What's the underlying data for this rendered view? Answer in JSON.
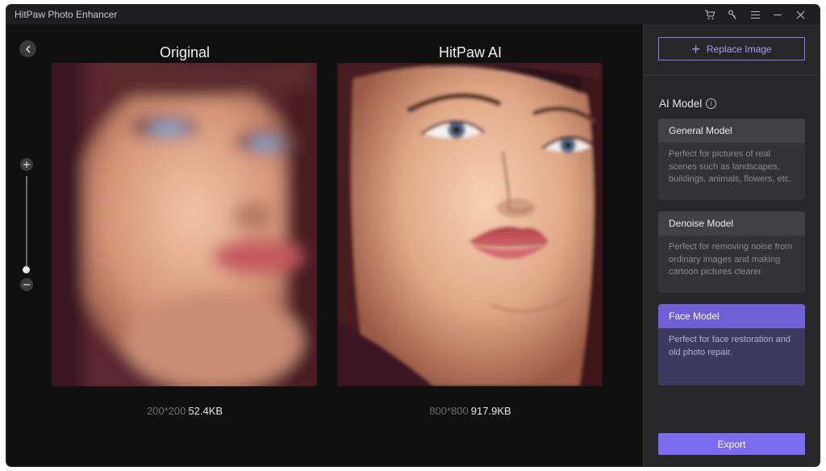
{
  "window": {
    "title": "HitPaw Photo Enhancer"
  },
  "titlebar_icons": [
    "cart-icon",
    "key-icon",
    "menu-icon",
    "minimize-icon",
    "close-icon"
  ],
  "panels": {
    "original": {
      "title": "Original",
      "dims": "200*200",
      "size": "52.4KB"
    },
    "enhanced": {
      "title": "HitPaw AI",
      "dims": "800*800",
      "size": "917.9KB"
    }
  },
  "zoom": {
    "level": 0.0
  },
  "sidebar": {
    "replace_label": "Replace Image",
    "ai_model_label": "AI Model",
    "models": [
      {
        "name": "General Model",
        "desc": "Perfect for pictures of real scenes such as landscapes, buildings, animals, flowers, etc.",
        "selected": false
      },
      {
        "name": "Denoise Model",
        "desc": "Perfect for removing noise from ordinary images and making cartoon pictures clearer.",
        "selected": false
      },
      {
        "name": "Face Model",
        "desc": "Perfect for face restoration and old photo repair.",
        "selected": true
      }
    ],
    "export_label": "Export"
  },
  "colors": {
    "accent": "#7b6cf0",
    "sidebar_bg": "#27272a",
    "main_bg": "#101011"
  }
}
